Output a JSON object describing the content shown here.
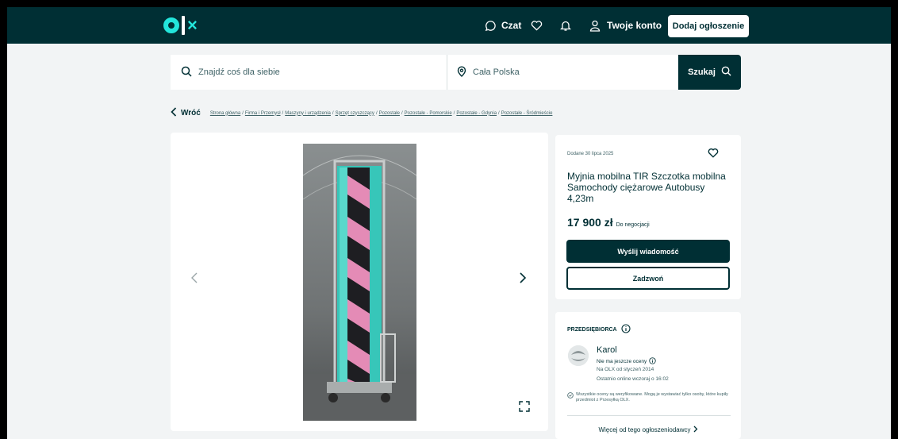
{
  "header": {
    "logo": "olx",
    "chat_label": "Czat",
    "account_label": "Twoje konto",
    "add_button_label": "Dodaj ogłoszenie",
    "icons": [
      "chat-icon",
      "heart-icon",
      "bell-icon",
      "user-icon"
    ]
  },
  "search": {
    "query_placeholder": "Znajdź coś dla siebie",
    "location_value": "Cała Polska",
    "button_label": "Szukaj"
  },
  "breadcrumb": {
    "back_label": "Wróć",
    "items": [
      "Strona główna",
      "Firma i Przemysł",
      "Maszyny i urządzenia",
      "Sprzęt czyszczący",
      "Pozostałe",
      "Pozostałe - Pomorskie",
      "Pozostałe - Gdynia",
      "Pozostałe - Śródmieście"
    ]
  },
  "ad": {
    "date_added": "Dodane 30 lipca 2025",
    "title": "Myjnia mobilna TIR Szczotka mobilna Samochody ciężarowe Autobusy 4,23m",
    "price": "17 900 zł",
    "negotiation": "Do negocjacji",
    "message_button": "Wyślij wiadomość",
    "call_button": "Zadzwoń"
  },
  "seller": {
    "type_label": "PRZEDSIĘBIORCA",
    "name": "Karol",
    "rating_text": "Nie ma jeszcze oceny",
    "member_since": "Na OLX od styczeń 2014",
    "last_online": "Ostatnio online wczoraj o 16:02",
    "verified_note": "Wszystkie oceny są weryfikowane. Mogą je wystawiać tylko osoby, które kupiły przedmiot z Przesyłką OLX.",
    "more_link": "Więcej od tego ogłoszeniodawcy"
  },
  "colors": {
    "brand_dark": "#002f34",
    "brand_accent": "#23e5db",
    "page_bg": "#f2f4f5"
  }
}
